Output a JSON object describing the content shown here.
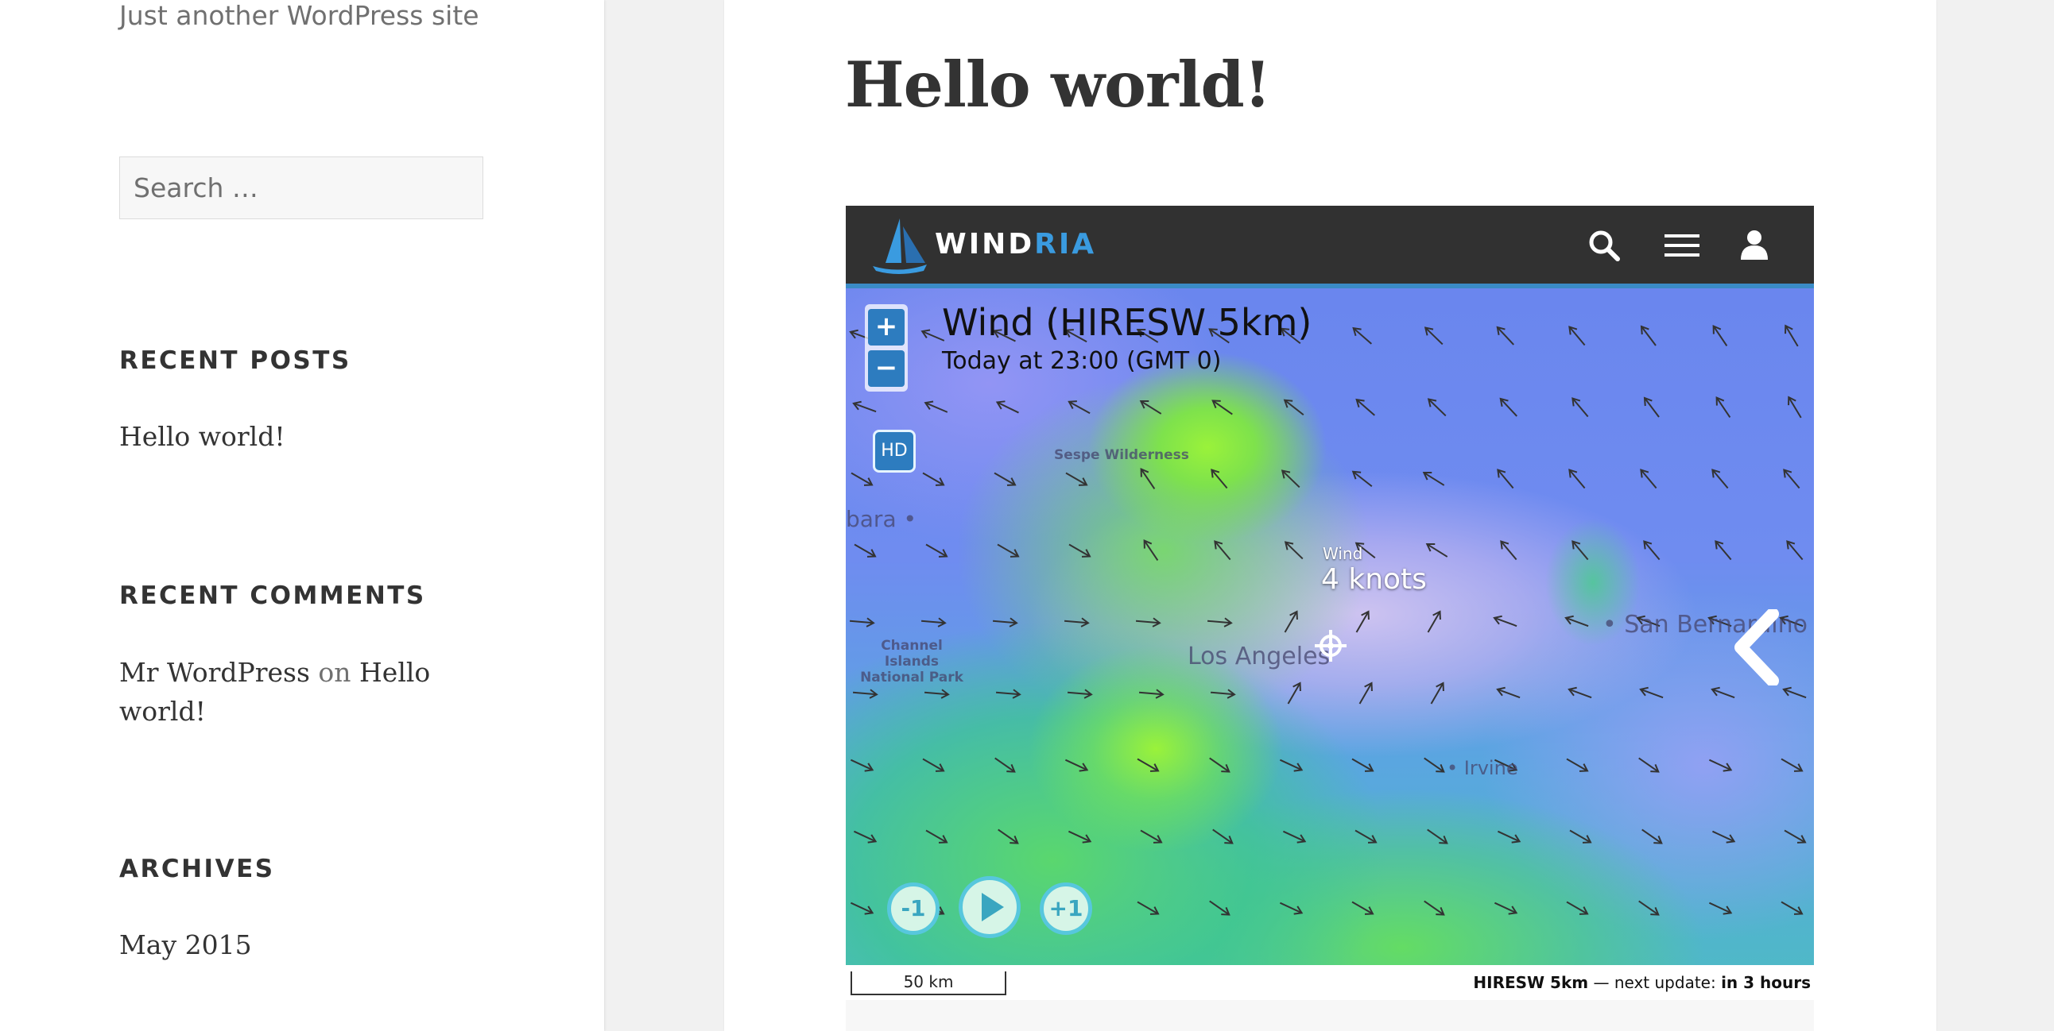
{
  "site": {
    "tagline": "Just another WordPress site"
  },
  "sidebar": {
    "search": {
      "placeholder": "Search …"
    },
    "recent_posts": {
      "title": "RECENT POSTS",
      "items": [
        "Hello world!"
      ]
    },
    "recent_comments": {
      "title": "RECENT COMMENTS",
      "items": [
        {
          "author": "Mr WordPress",
          "on": "on",
          "post_line1": "Hello",
          "post_line2": "world!"
        }
      ]
    },
    "archives": {
      "title": "ARCHIVES",
      "items": [
        "May 2015"
      ]
    }
  },
  "post": {
    "title": "Hello world!"
  },
  "widget": {
    "brand": {
      "part1": "WIND",
      "part2": "RIA"
    },
    "header_icons": [
      "search-icon",
      "menu-icon",
      "user-icon"
    ],
    "colors": {
      "header_bg": "#313131",
      "accent": "#3a8bc6",
      "brand_blue": "#3a9be0",
      "button_blue": "#2d7cbf",
      "play_ring": "#57c7dd"
    },
    "zoom": {
      "in": "+",
      "out": "−"
    },
    "hd": "HD",
    "map_title": "Wind (HIRESW 5km)",
    "map_subtitle": "Today at 23:00 (GMT 0)",
    "places": {
      "sespe": "Sespe Wilderness",
      "barbara": "bara •",
      "channel_islands_1": "Channel Islands",
      "channel_islands_2": "National Park",
      "los_angeles": "Los Angeles",
      "san_bernardino": "• San Bernardino",
      "irvine": "• Irvine"
    },
    "probe": {
      "label": "Wind",
      "value": "4 knots"
    },
    "playback": {
      "prev": "-1",
      "next": "+1"
    },
    "scale": "50 km",
    "update": {
      "model": "HIRESW 5km",
      "middle": " — next update: ",
      "when": "in 3 hours"
    }
  }
}
